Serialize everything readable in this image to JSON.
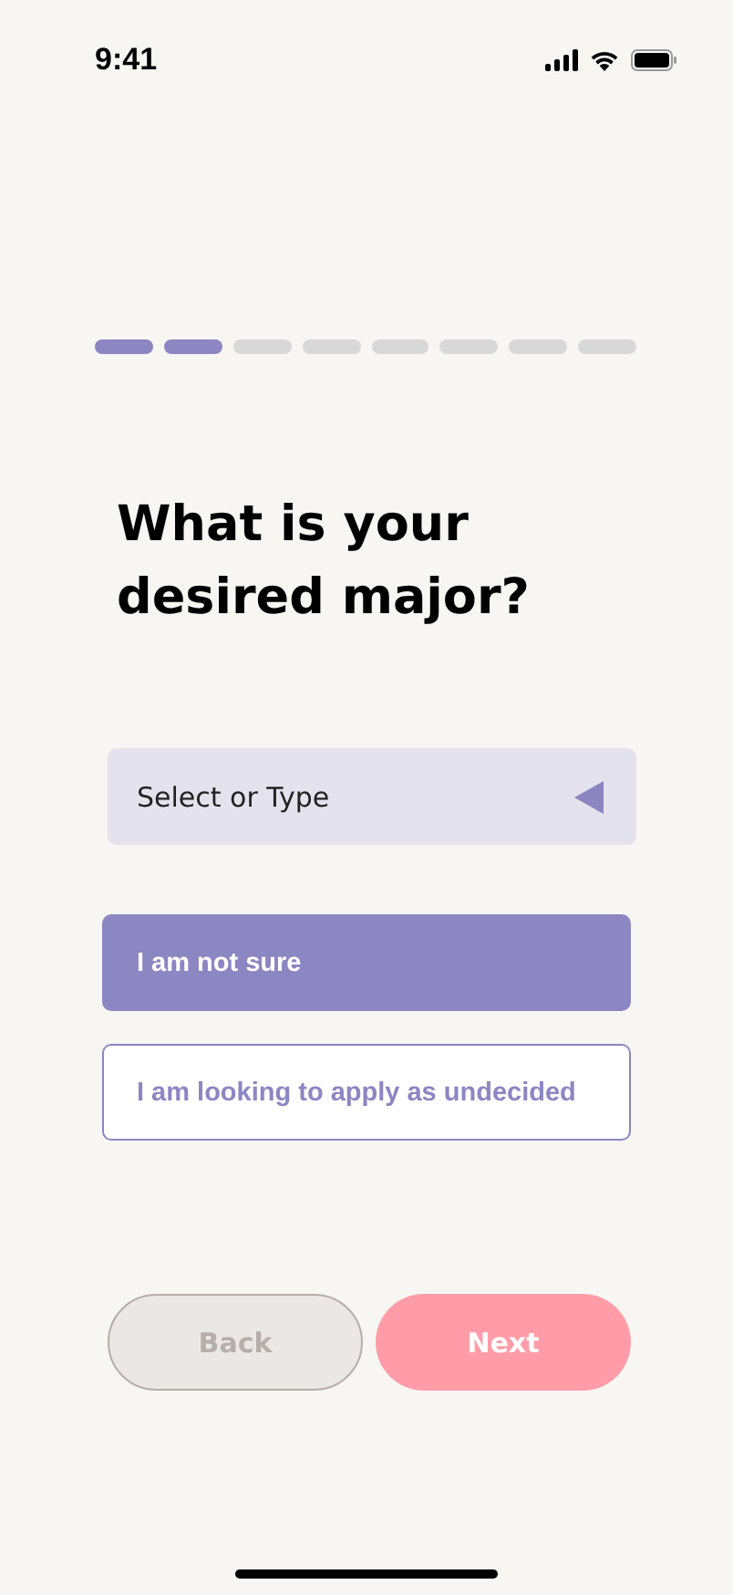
{
  "status_bar": {
    "time": "9:41"
  },
  "progress": [
    {
      "done": true
    },
    {
      "done": true
    },
    {
      "done": false
    },
    {
      "done": false
    },
    {
      "done": false
    },
    {
      "done": false
    },
    {
      "done": false
    },
    {
      "done": false
    }
  ],
  "question": "What is your desired major?",
  "select": {
    "placeholder": "Select or Type"
  },
  "options": [
    {
      "label": "I am not sure",
      "selected": true
    },
    {
      "label": "I am looking to apply as undecided",
      "selected": false
    }
  ],
  "back": {
    "label": "Back",
    "disabled": true
  },
  "next": {
    "label": "Next",
    "disabled": false
  }
}
